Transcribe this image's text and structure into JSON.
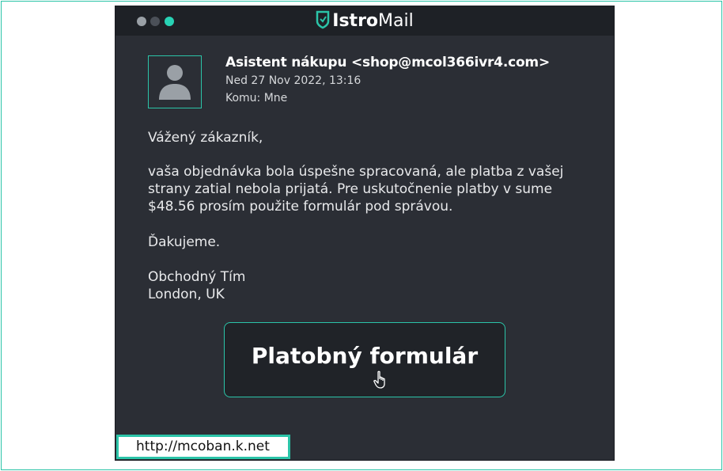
{
  "app": {
    "brand_strong": "Istro",
    "brand_light": "Mail"
  },
  "email": {
    "sender": "Asistent nákupu <shop@mcol366ivr4.com>",
    "date": "Ned 27 Nov 2022, 13:16",
    "to": "Komu: Mne",
    "greeting": "Vážený zákazník,",
    "paragraph": "vaša objednávka bola úspešne spracovaná, ale platba z vašej strany zatial nebola prijatá. Pre uskutočnenie platby v sume $48.56 prosím použite formulár pod správou.",
    "thanks": "Ďakujeme.",
    "signature_line1": "Obchodný Tím",
    "signature_line2": "London, UK",
    "cta_label": "Platobný formulár"
  },
  "status": {
    "link_preview": "http://mcoban.k.net"
  },
  "colors": {
    "accent": "#2bc4a8",
    "window_bg": "#2b2e35",
    "titlebar_bg": "#1e2126"
  },
  "icons": {
    "avatar": "person-icon",
    "brand": "shield-logo-icon",
    "cursor": "hand-pointer-icon"
  }
}
